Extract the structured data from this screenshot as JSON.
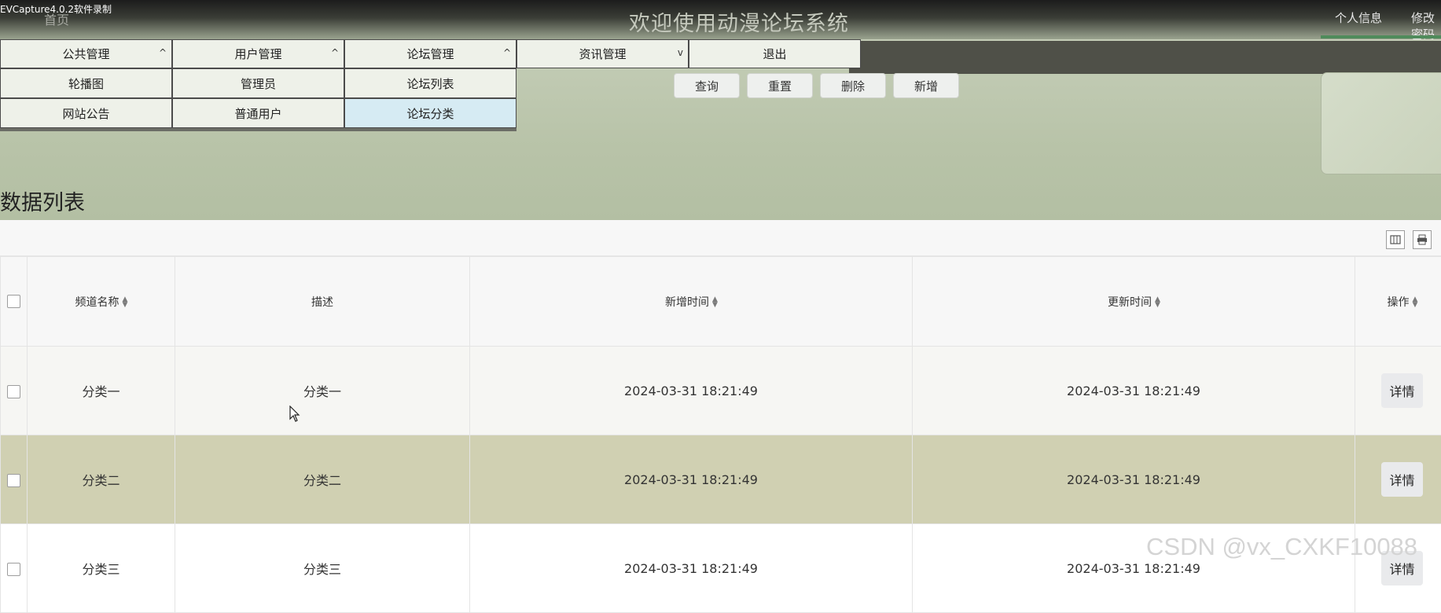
{
  "recorder_label": "EVCapture4.0.2软件录制",
  "header": {
    "home_label": "首页",
    "title": "欢迎使用动漫论坛系统",
    "profile_link": "个人信息",
    "password_link": "修改密码"
  },
  "menu": [
    {
      "label": "公共管理",
      "chevron": "^",
      "submenu": [
        "轮播图",
        "网站公告"
      ]
    },
    {
      "label": "用户管理",
      "chevron": "^",
      "submenu": [
        "管理员",
        "普通用户"
      ]
    },
    {
      "label": "论坛管理",
      "chevron": "^",
      "submenu": [
        "论坛列表",
        "论坛分类"
      ]
    },
    {
      "label": "资讯管理",
      "chevron": "v"
    },
    {
      "label": "退出"
    }
  ],
  "active_submenu": "论坛分类",
  "actions": {
    "query": "查询",
    "reset": "重置",
    "delete": "删除",
    "add": "新增"
  },
  "section_title": "数据列表",
  "table": {
    "columns": [
      "频道名称",
      "描述",
      "新增时间",
      "更新时间",
      "操作"
    ],
    "rows": [
      {
        "name": "分类一",
        "desc": "分类一",
        "created": "2024-03-31 18:21:49",
        "updated": "2024-03-31 18:21:49",
        "action": "详情"
      },
      {
        "name": "分类二",
        "desc": "分类二",
        "created": "2024-03-31 18:21:49",
        "updated": "2024-03-31 18:21:49",
        "action": "详情"
      },
      {
        "name": "分类三",
        "desc": "分类三",
        "created": "2024-03-31 18:21:49",
        "updated": "2024-03-31 18:21:49",
        "action": "详情"
      }
    ]
  },
  "watermark": "CSDN @vx_CXKF10088",
  "icons": {
    "columns_toggle": "columns-icon",
    "print": "print-icon",
    "sort": "sort-icon",
    "chevron_up": "chevron-up-icon",
    "chevron_down": "chevron-down-icon"
  },
  "colors": {
    "header_dark": "#1c1c1c",
    "menu_bg": "#eef1e9",
    "active_submenu_bg": "#d6ebf3",
    "highlight_row": "#d0d0b2",
    "accent_underline": "#4f8b5b"
  }
}
